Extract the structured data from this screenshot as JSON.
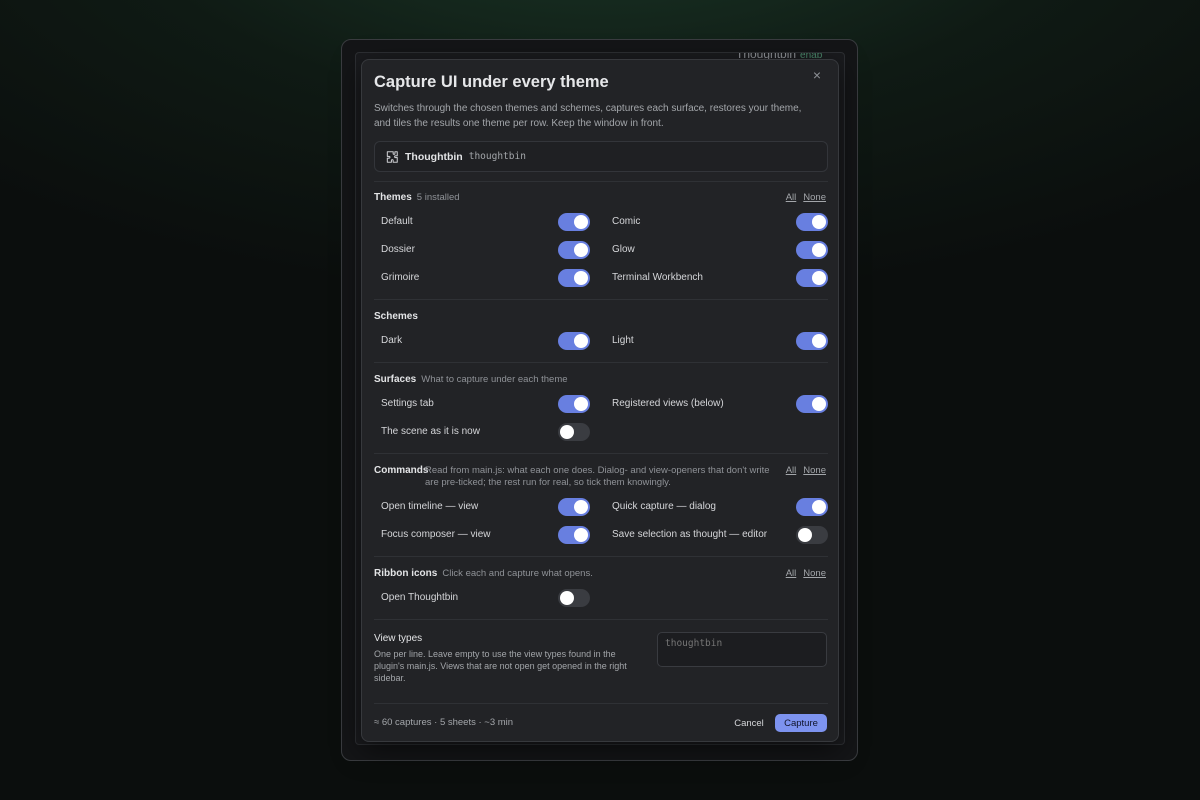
{
  "background": {
    "app_title": "Thoughtbin",
    "app_badge": "enab"
  },
  "modal": {
    "title": "Capture UI under every theme",
    "description": "Switches through the chosen themes and schemes, captures each surface, restores your theme, and tiles the results one theme per row. Keep the window in front.",
    "close_label": "×",
    "plugin": {
      "name": "Thoughtbin",
      "id": "thoughtbin",
      "icon": "puzzle-piece-icon"
    },
    "themes": {
      "heading": "Themes",
      "sub": "5 installed",
      "all_label": "All",
      "none_label": "None",
      "items": [
        {
          "label": "Default",
          "on": true
        },
        {
          "label": "Comic",
          "on": true
        },
        {
          "label": "Dossier",
          "on": true
        },
        {
          "label": "Glow",
          "on": true
        },
        {
          "label": "Grimoire",
          "on": true
        },
        {
          "label": "Terminal Workbench",
          "on": true
        }
      ]
    },
    "schemes": {
      "heading": "Schemes",
      "items": [
        {
          "label": "Dark",
          "on": true
        },
        {
          "label": "Light",
          "on": true
        }
      ]
    },
    "surfaces": {
      "heading": "Surfaces",
      "sub": "What to capture under each theme",
      "items": [
        {
          "label": "Settings tab",
          "on": true
        },
        {
          "label": "Registered views (below)",
          "on": true
        },
        {
          "label": "The scene as it is now",
          "on": false
        }
      ]
    },
    "commands": {
      "heading": "Commands",
      "sub": "Read from main.js: what each one does. Dialog- and view-openers that don't write are pre-ticked; the rest run for real, so tick them knowingly.",
      "all_label": "All",
      "none_label": "None",
      "items": [
        {
          "label": "Open timeline — view",
          "on": true
        },
        {
          "label": "Quick capture — dialog",
          "on": true
        },
        {
          "label": "Focus composer — view",
          "on": true
        },
        {
          "label": "Save selection as thought — editor",
          "on": false
        }
      ]
    },
    "ribbon": {
      "heading": "Ribbon icons",
      "sub": "Click each and capture what opens.",
      "all_label": "All",
      "none_label": "None",
      "items": [
        {
          "label": "Open Thoughtbin",
          "on": false
        }
      ]
    },
    "view_types": {
      "title": "View types",
      "description": "One per line. Leave empty to use the view types found in the plugin's main.js. Views that are not open get opened in the right sidebar.",
      "placeholder": "thoughtbin"
    },
    "footer": {
      "info": "≈ 60 captures · 5 sheets · ~3 min",
      "cancel_label": "Cancel",
      "capture_label": "Capture"
    }
  }
}
